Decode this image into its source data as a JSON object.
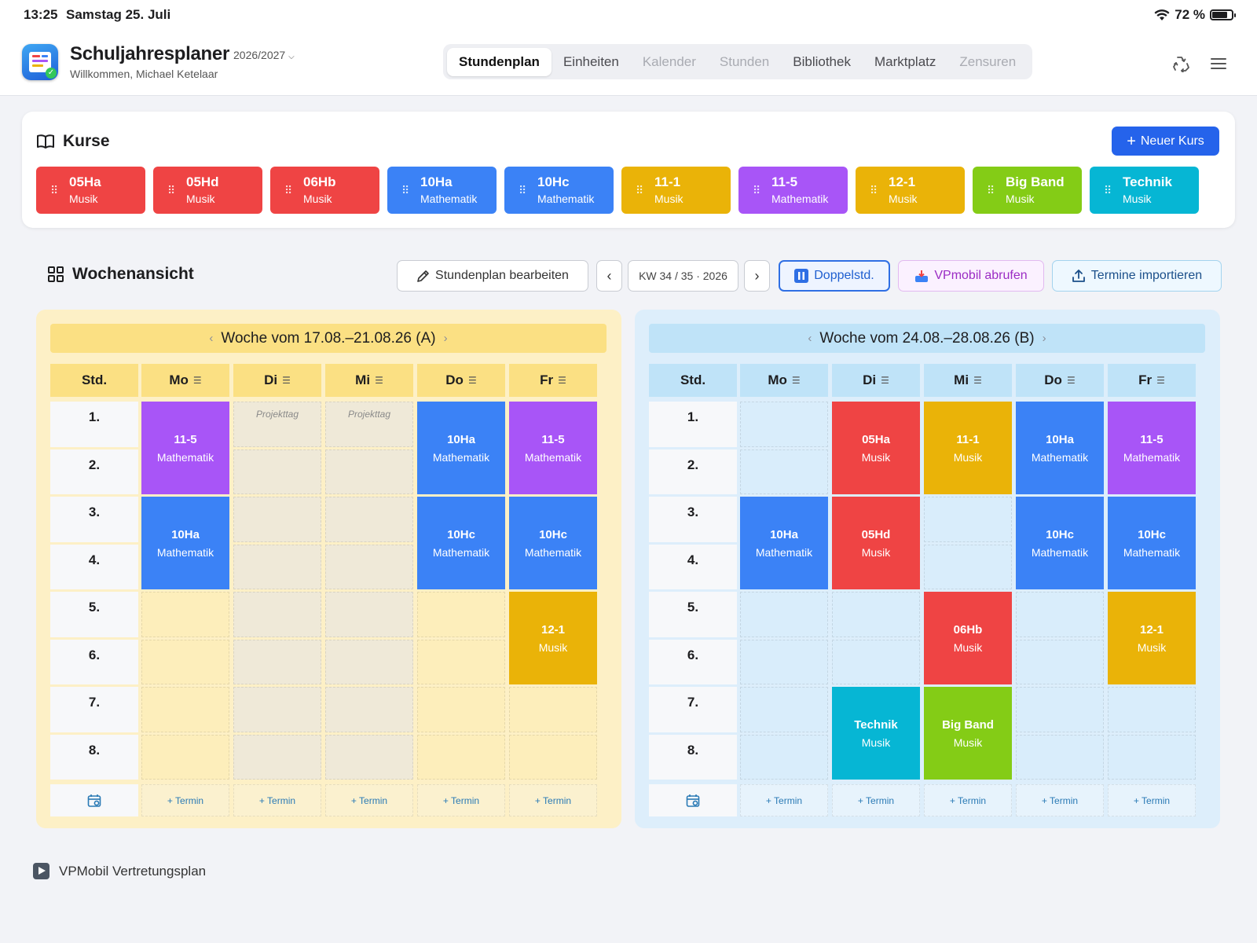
{
  "status": {
    "time": "13:25",
    "date": "Samstag 25. Juli",
    "battery": "72 %"
  },
  "app": {
    "title": "Schuljahresplaner",
    "year": "2026/2027",
    "welcome": "Willkommen, Michael Ketelaar"
  },
  "tabs": [
    {
      "label": "Stundenplan",
      "state": "active"
    },
    {
      "label": "Einheiten",
      "state": "normal"
    },
    {
      "label": "Kalender",
      "state": "disabled"
    },
    {
      "label": "Stunden",
      "state": "disabled"
    },
    {
      "label": "Bibliothek",
      "state": "normal"
    },
    {
      "label": "Marktplatz",
      "state": "normal"
    },
    {
      "label": "Zensuren",
      "state": "disabled"
    }
  ],
  "courses": {
    "title": "Kurse",
    "new_label": "Neuer Kurs",
    "items": [
      {
        "name": "05Ha",
        "subject": "Musik",
        "color": "#ef4444"
      },
      {
        "name": "05Hd",
        "subject": "Musik",
        "color": "#ef4444"
      },
      {
        "name": "06Hb",
        "subject": "Musik",
        "color": "#ef4444"
      },
      {
        "name": "10Ha",
        "subject": "Mathematik",
        "color": "#3b82f6"
      },
      {
        "name": "10Hc",
        "subject": "Mathematik",
        "color": "#3b82f6"
      },
      {
        "name": "11-1",
        "subject": "Musik",
        "color": "#eab308"
      },
      {
        "name": "11-5",
        "subject": "Mathematik",
        "color": "#a855f7"
      },
      {
        "name": "12-1",
        "subject": "Musik",
        "color": "#eab308"
      },
      {
        "name": "Big Band",
        "subject": "Musik",
        "color": "#84cc16"
      },
      {
        "name": "Technik",
        "subject": "Musik",
        "color": "#06b6d4"
      }
    ]
  },
  "weekview": {
    "title": "Wochenansicht",
    "edit_label": "Stundenplan bearbeiten",
    "kw_label": "KW 34 / 35 · 2026",
    "double_label": "Doppelstd.",
    "vpmobil_label": "VPmobil abrufen",
    "import_label": "Termine importieren"
  },
  "weeks": [
    {
      "label": "Woche vom 17.08.–21.08.26 (A)",
      "head": "Std.",
      "days": [
        "Mo",
        "Di",
        "Mi",
        "Do",
        "Fr"
      ],
      "periods": [
        "1.",
        "2.",
        "3.",
        "4.",
        "5.",
        "6.",
        "7.",
        "8."
      ],
      "termin_label": "+ Termin",
      "note_days": [
        1,
        2
      ],
      "note_text": "Projekttag",
      "lessons": [
        {
          "day": 0,
          "start": 0,
          "span": 2,
          "name": "11-5",
          "subject": "Mathematik",
          "color": "#a855f7"
        },
        {
          "day": 0,
          "start": 2,
          "span": 2,
          "name": "10Ha",
          "subject": "Mathematik",
          "color": "#3b82f6"
        },
        {
          "day": 3,
          "start": 0,
          "span": 2,
          "name": "10Ha",
          "subject": "Mathematik",
          "color": "#3b82f6"
        },
        {
          "day": 3,
          "start": 2,
          "span": 2,
          "name": "10Hc",
          "subject": "Mathematik",
          "color": "#3b82f6"
        },
        {
          "day": 4,
          "start": 0,
          "span": 2,
          "name": "11-5",
          "subject": "Mathematik",
          "color": "#a855f7"
        },
        {
          "day": 4,
          "start": 2,
          "span": 2,
          "name": "10Hc",
          "subject": "Mathematik",
          "color": "#3b82f6"
        },
        {
          "day": 4,
          "start": 4,
          "span": 2,
          "name": "12-1",
          "subject": "Musik",
          "color": "#eab308"
        }
      ]
    },
    {
      "label": "Woche vom 24.08.–28.08.26 (B)",
      "head": "Std.",
      "days": [
        "Mo",
        "Di",
        "Mi",
        "Do",
        "Fr"
      ],
      "periods": [
        "1.",
        "2.",
        "3.",
        "4.",
        "5.",
        "6.",
        "7.",
        "8."
      ],
      "termin_label": "+ Termin",
      "note_days": [],
      "note_text": "",
      "lessons": [
        {
          "day": 0,
          "start": 2,
          "span": 2,
          "name": "10Ha",
          "subject": "Mathematik",
          "color": "#3b82f6"
        },
        {
          "day": 1,
          "start": 0,
          "span": 2,
          "name": "05Ha",
          "subject": "Musik",
          "color": "#ef4444"
        },
        {
          "day": 1,
          "start": 2,
          "span": 2,
          "name": "05Hd",
          "subject": "Musik",
          "color": "#ef4444"
        },
        {
          "day": 1,
          "start": 6,
          "span": 2,
          "name": "Technik",
          "subject": "Musik",
          "color": "#06b6d4"
        },
        {
          "day": 2,
          "start": 0,
          "span": 2,
          "name": "11-1",
          "subject": "Musik",
          "color": "#eab308"
        },
        {
          "day": 2,
          "start": 4,
          "span": 2,
          "name": "06Hb",
          "subject": "Musik",
          "color": "#ef4444"
        },
        {
          "day": 2,
          "start": 6,
          "span": 2,
          "name": "Big Band",
          "subject": "Musik",
          "color": "#84cc16"
        },
        {
          "day": 3,
          "start": 0,
          "span": 2,
          "name": "10Ha",
          "subject": "Mathematik",
          "color": "#3b82f6"
        },
        {
          "day": 3,
          "start": 2,
          "span": 2,
          "name": "10Hc",
          "subject": "Mathematik",
          "color": "#3b82f6"
        },
        {
          "day": 4,
          "start": 0,
          "span": 2,
          "name": "11-5",
          "subject": "Mathematik",
          "color": "#a855f7"
        },
        {
          "day": 4,
          "start": 2,
          "span": 2,
          "name": "10Hc",
          "subject": "Mathematik",
          "color": "#3b82f6"
        },
        {
          "day": 4,
          "start": 4,
          "span": 2,
          "name": "12-1",
          "subject": "Musik",
          "color": "#eab308"
        }
      ]
    }
  ],
  "footer": {
    "vp_label": "VPMobil Vertretungsplan"
  }
}
